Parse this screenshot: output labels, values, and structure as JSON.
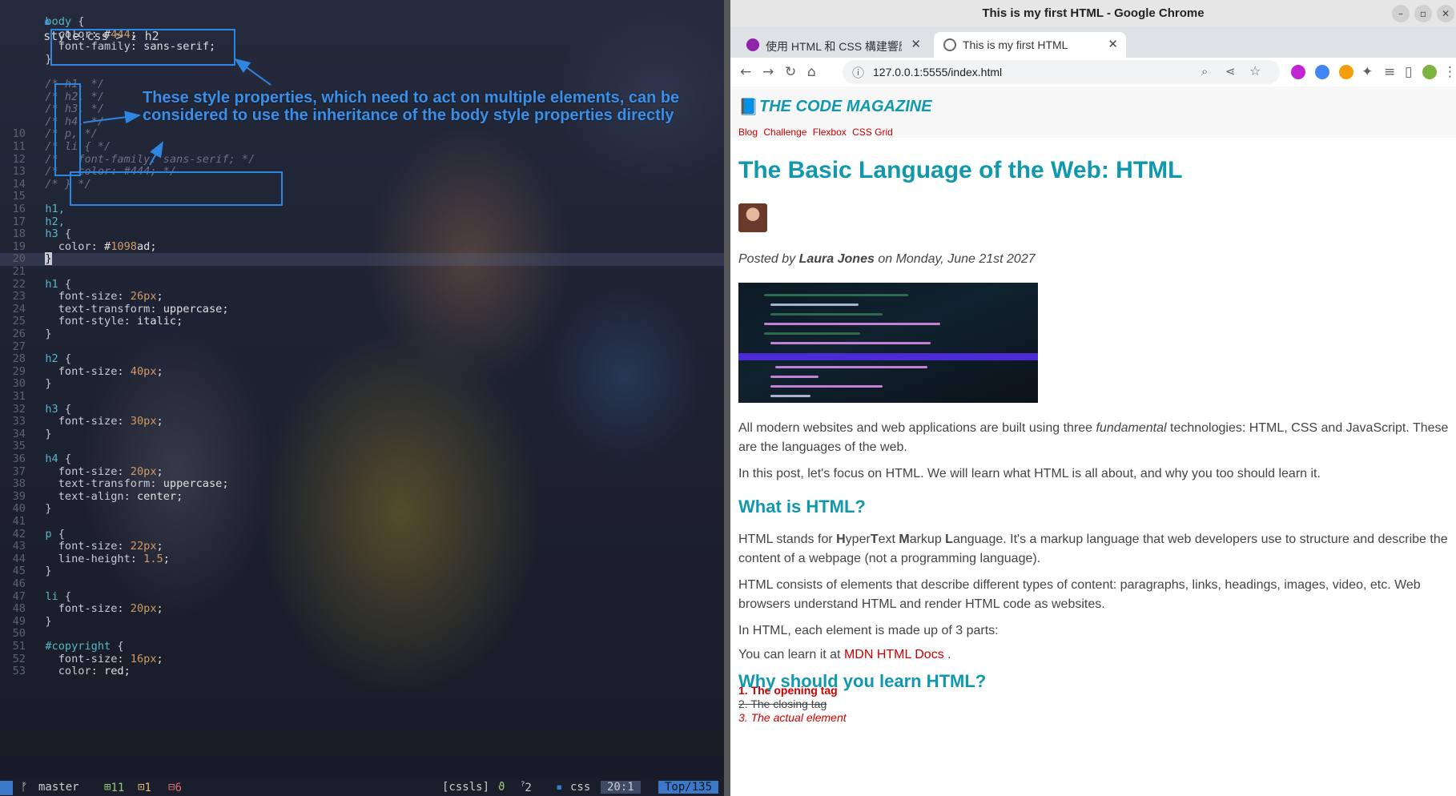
{
  "editor": {
    "breadcrumb": "style.css > ₂ h2",
    "annotation": "These style properties, which need to act on multiple elements, can be considered to use the inheritance of the body style properties directly",
    "lines": [
      {
        "n": "",
        "t": "  body {"
      },
      {
        "n": "",
        "t": "    color: #444;"
      },
      {
        "n": "",
        "t": "    font-family: sans-serif;"
      },
      {
        "n": "",
        "t": "  }"
      },
      {
        "n": "",
        "t": ""
      },
      {
        "n": "",
        "t": "  /* h1, */"
      },
      {
        "n": "",
        "t": "  /* h2, */"
      },
      {
        "n": "",
        "t": "  /* h3, */"
      },
      {
        "n": "",
        "t": "  /* h4, */"
      },
      {
        "n": "10",
        "t": "  /* p, */"
      },
      {
        "n": "11",
        "t": "  /* li { */"
      },
      {
        "n": "12",
        "t": "  /*   font-family: sans-serif; */"
      },
      {
        "n": "13",
        "t": "  /*   color: #444; */"
      },
      {
        "n": "14",
        "t": "  /* } */"
      },
      {
        "n": "15",
        "t": ""
      },
      {
        "n": "16",
        "t": "  h1,"
      },
      {
        "n": "17",
        "t": "  h2,"
      },
      {
        "n": "18",
        "t": "  h3 {"
      },
      {
        "n": "19",
        "t": "    color: #1098ad;"
      },
      {
        "n": "20",
        "t": "  }"
      },
      {
        "n": "21",
        "t": ""
      },
      {
        "n": "22",
        "t": "  h1 {"
      },
      {
        "n": "23",
        "t": "    font-size: 26px;"
      },
      {
        "n": "24",
        "t": "    text-transform: uppercase;"
      },
      {
        "n": "25",
        "t": "    font-style: italic;"
      },
      {
        "n": "26",
        "t": "  }"
      },
      {
        "n": "27",
        "t": ""
      },
      {
        "n": "28",
        "t": "  h2 {"
      },
      {
        "n": "29",
        "t": "    font-size: 40px;"
      },
      {
        "n": "30",
        "t": "  }"
      },
      {
        "n": "31",
        "t": ""
      },
      {
        "n": "32",
        "t": "  h3 {"
      },
      {
        "n": "33",
        "t": "    font-size: 30px;"
      },
      {
        "n": "34",
        "t": "  }"
      },
      {
        "n": "35",
        "t": ""
      },
      {
        "n": "36",
        "t": "  h4 {"
      },
      {
        "n": "37",
        "t": "    font-size: 20px;"
      },
      {
        "n": "38",
        "t": "    text-transform: uppercase;"
      },
      {
        "n": "39",
        "t": "    text-align: center;"
      },
      {
        "n": "40",
        "t": "  }"
      },
      {
        "n": "41",
        "t": ""
      },
      {
        "n": "42",
        "t": "  p {"
      },
      {
        "n": "43",
        "t": "    font-size: 22px;"
      },
      {
        "n": "44",
        "t": "    line-height: 1.5;"
      },
      {
        "n": "45",
        "t": "  }"
      },
      {
        "n": "46",
        "t": ""
      },
      {
        "n": "47",
        "t": "  li {"
      },
      {
        "n": "48",
        "t": "    font-size: 20px;"
      },
      {
        "n": "49",
        "t": "  }"
      },
      {
        "n": "50",
        "t": ""
      },
      {
        "n": "51",
        "t": "  #copyright {"
      },
      {
        "n": "52",
        "t": "    font-size: 16px;"
      },
      {
        "n": "53",
        "t": "    color: red;"
      }
    ],
    "status": {
      "branch": "master",
      "added": "11",
      "changed": "1",
      "removed": "6",
      "lsp": "[cssls]",
      "diag": "2",
      "filetype": "css",
      "position": "20:1",
      "scroll": "Top/135"
    }
  },
  "browser": {
    "window_title": "This is my first HTML - Google Chrome",
    "tabs": [
      {
        "label": "使用 HTML 和 CSS 構建響應",
        "active": false
      },
      {
        "label": "This is my first HTML",
        "active": true
      }
    ],
    "url": "127.0.0.1:5555/index.html",
    "page": {
      "magazine_title": "THE CODE MAGAZINE",
      "nav": [
        "Blog",
        "Challenge",
        "Flexbox",
        "CSS Grid"
      ],
      "h1": "The Basic Language of the Web: HTML",
      "byline": {
        "prefix": "Posted by ",
        "author": "Laura Jones",
        "suffix": " on Monday, June 21st 2027"
      },
      "p1": {
        "a": "All modern websites and web applications are built using three ",
        "em": "fundamental",
        "b": " technologies: HTML, CSS and JavaScript. These are the languages of the web."
      },
      "p2": "In this post, let's focus on HTML. We will learn what HTML is all about, and why you too should learn it.",
      "h2_1": "What is HTML?",
      "p3": {
        "a": "HTML stands for ",
        "H": "H",
        "yper": "yper",
        "T": "T",
        "ext": "ext ",
        "M": "M",
        "arkup": "arkup ",
        "L": "L",
        "rest": "anguage. It's a markup language that web developers use to structure and describe the content of a webpage (not a programming language)."
      },
      "p4": "HTML consists of elements that describe different types of content: paragraphs, links, headings, images, video, etc. Web browsers understand HTML and render HTML code as websites.",
      "p5": "In HTML, each element is made up of 3 parts:",
      "list": [
        "The opening tag",
        "The closing tag",
        "The actual element"
      ],
      "p6": {
        "a": "You can learn it at ",
        "link": "MDN HTML Docs",
        "b": " ."
      },
      "h2_2": "Why should you learn HTML?"
    }
  },
  "colors": {
    "accent": "#1098ad",
    "text": "#444444",
    "link": "#cc0000",
    "annotation": "#2f86e0"
  }
}
